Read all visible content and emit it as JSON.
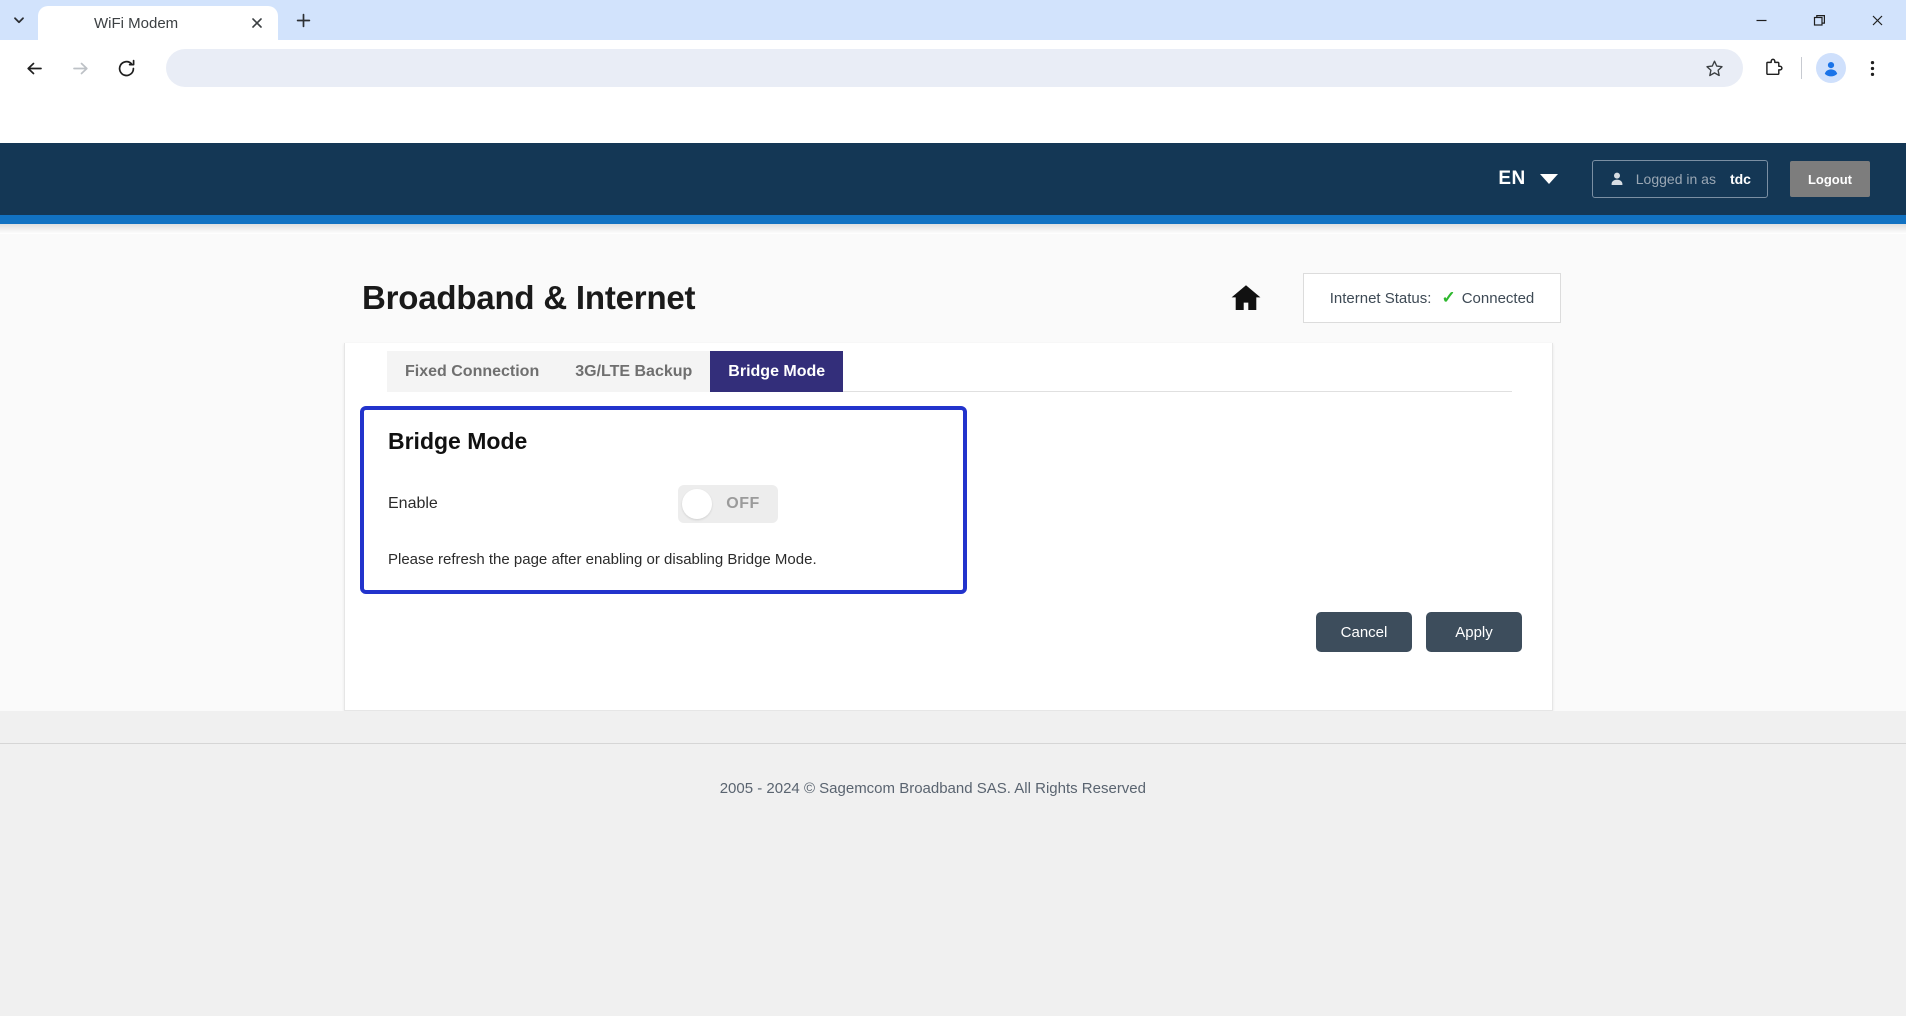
{
  "browser": {
    "tab_search_icon": "chevron-down-icon",
    "tabs": [
      {
        "title": "WiFi Modem",
        "close_icon": "close-icon"
      }
    ],
    "new_tab_icon": "plus-icon",
    "window_controls": {
      "minimize_icon": "minimize-icon",
      "maximize_icon": "restore-icon",
      "close_icon": "close-icon"
    },
    "toolbar": {
      "back_icon": "back-arrow-icon",
      "forward_icon": "forward-arrow-icon",
      "reload_icon": "reload-icon",
      "address_value": "",
      "address_placeholder": "",
      "bookmark_icon": "star-icon",
      "extensions_icon": "puzzle-piece-icon",
      "profile_icon": "avatar-icon",
      "menu_icon": "three-dot-menu-icon"
    }
  },
  "app_header": {
    "language": "EN",
    "language_caret_icon": "caret-down-icon",
    "person_icon": "person-icon",
    "logged_in_label": "Logged in as",
    "logged_in_user": "tdc",
    "logout_label": "Logout",
    "accent_color": "#1272c2",
    "header_color": "#143755"
  },
  "page": {
    "title": "Broadband & Internet",
    "home_icon": "home-icon",
    "status": {
      "label": "Internet Status:",
      "check_icon": "check-icon",
      "value": "Connected",
      "check_color": "#2eb82e"
    }
  },
  "tabs": {
    "items": [
      {
        "label": "Fixed Connection",
        "active": false
      },
      {
        "label": "3G/LTE Backup",
        "active": false
      },
      {
        "label": "Bridge Mode",
        "active": true
      }
    ],
    "active_color": "#332e7a"
  },
  "bridge_panel": {
    "title": "Bridge Mode",
    "enable_label": "Enable",
    "toggle_state": "OFF",
    "toggle_on": false,
    "note": "Please refresh the page after enabling or disabling Bridge Mode.",
    "border_color": "#2233cc"
  },
  "actions": {
    "cancel_label": "Cancel",
    "apply_label": "Apply"
  },
  "footer": {
    "copyright": "2005 - 2024 © Sagemcom Broadband SAS. All Rights Reserved"
  }
}
